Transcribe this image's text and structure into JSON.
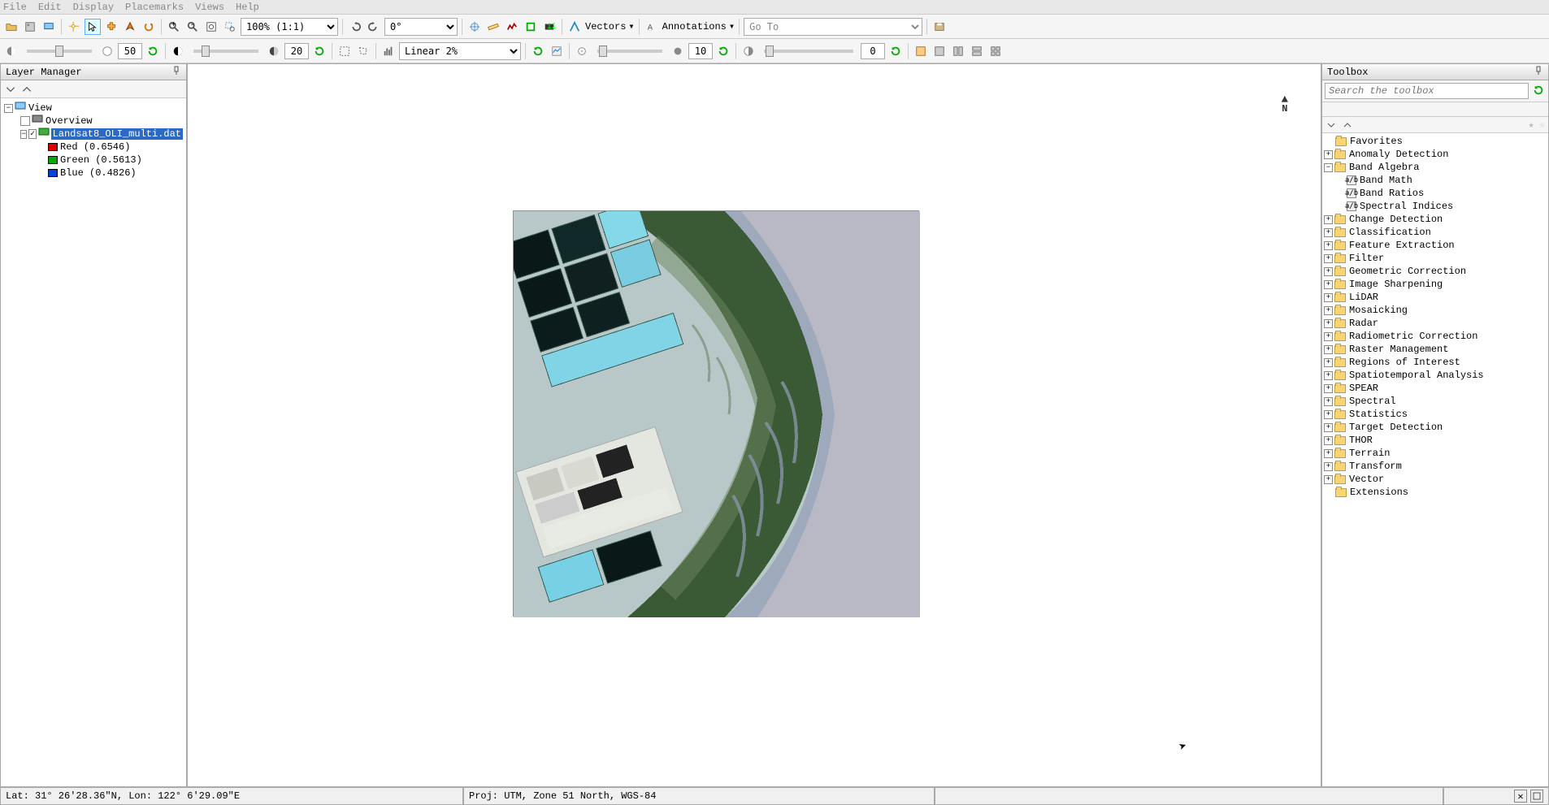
{
  "menu": [
    "File",
    "Edit",
    "Display",
    "Placemarks",
    "Views",
    "Help"
  ],
  "toolbar1": {
    "zoom": "100% (1:1)",
    "rotate": "0°",
    "vectors_label": "Vectors",
    "annotations_label": "Annotations",
    "goto_label": "Go To"
  },
  "toolbar2": {
    "val1": "50",
    "val2": "20",
    "stretch": "Linear 2%",
    "val3": "10",
    "val4": "0"
  },
  "layer_panel": {
    "title": "Layer Manager",
    "view_label": "View",
    "overview_label": "Overview",
    "dataset": "Landsat8_OLI_multi.dat",
    "bands": [
      {
        "name": "Red (0.6546)",
        "color": "#d00"
      },
      {
        "name": "Green (0.5613)",
        "color": "#0a0"
      },
      {
        "name": "Blue (0.4826)",
        "color": "#04d"
      }
    ]
  },
  "toolbox": {
    "title": "Toolbox",
    "search_placeholder": "Search the toolbox",
    "favorites": "Favorites",
    "band_algebra": {
      "label": "Band Algebra",
      "children": [
        "Band Math",
        "Band Ratios",
        "Spectral Indices"
      ]
    },
    "folders": [
      "Anomaly Detection",
      "Change Detection",
      "Classification",
      "Feature Extraction",
      "Filter",
      "Geometric Correction",
      "Image Sharpening",
      "LiDAR",
      "Mosaicking",
      "Radar",
      "Radiometric Correction",
      "Raster Management",
      "Regions of Interest",
      "Spatiotemporal Analysis",
      "SPEAR",
      "Spectral",
      "Statistics",
      "Target Detection",
      "THOR",
      "Terrain",
      "Transform",
      "Vector",
      "Extensions"
    ]
  },
  "north_label": "N",
  "status": {
    "latlon": "Lat: 31° 26'28.36\"N, Lon: 122° 6'29.09\"E",
    "proj": "Proj: UTM, Zone 51 North, WGS-84"
  }
}
